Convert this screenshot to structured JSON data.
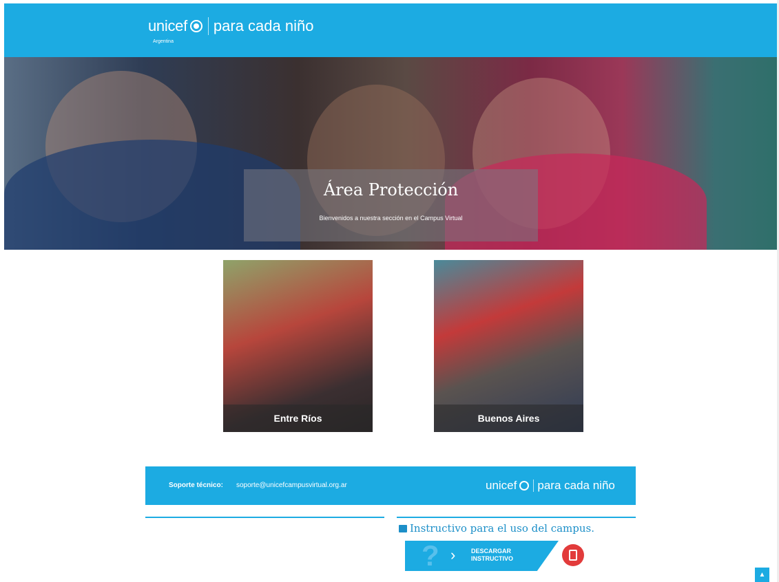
{
  "header": {
    "brand": "unicef",
    "tagline": "para cada niño",
    "country": "Argentina"
  },
  "hero": {
    "title": "Área Protección",
    "subtitle": "Bienvenidos a nuestra sección en el Campus Virtual"
  },
  "cards": [
    {
      "caption": "Entre Ríos"
    },
    {
      "caption": "Buenos Aires"
    }
  ],
  "footer": {
    "support_label": "Soporte técnico:",
    "support_email": "soporte@unicefcampusvirtual.org.ar",
    "brand": "unicef",
    "tagline": "para cada niño",
    "instructivo_title": "Instructivo para el uso del campus.",
    "download_label_line1": "DESCARGAR",
    "download_label_line2": "INSTRUCTIVO",
    "pdf_icon": "pdf-icon",
    "totop_icon": "chevron-up-icon"
  },
  "colors": {
    "brand_blue": "#1cabe2",
    "pdf_red": "#e23b3b"
  }
}
